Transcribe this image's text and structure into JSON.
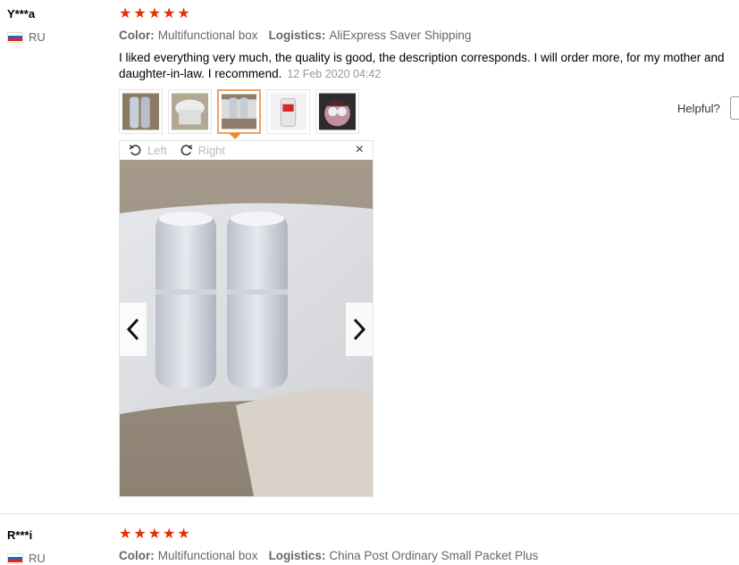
{
  "reviews": [
    {
      "user": "Y***a",
      "country": "RU",
      "rating": 5,
      "color_label": "Color:",
      "color_value": "Multifunctional box",
      "logistics_label": "Logistics:",
      "logistics_value": "AliExpress Saver Shipping",
      "text": "I liked everything very much, the quality is good, the description corresponds. I will order more, for my mother and daughter-in-law. I recommend.",
      "date": "12 Feb 2020 04:42",
      "helpful_label": "Helpful?",
      "viewer": {
        "rotate_left": "Left",
        "rotate_right": "Right",
        "close": "×"
      }
    },
    {
      "user": "R***i",
      "country": "RU",
      "rating": 5,
      "color_label": "Color:",
      "color_value": "Multifunctional box",
      "logistics_label": "Logistics:",
      "logistics_value": "China Post Ordinary Small Packet Plus"
    }
  ],
  "thumbnails": [
    "photo-1",
    "photo-2",
    "photo-3",
    "photo-4",
    "photo-5"
  ],
  "active_thumbnail": 2,
  "colors": {
    "star": "#e62e04",
    "accent": "#f08a24"
  }
}
